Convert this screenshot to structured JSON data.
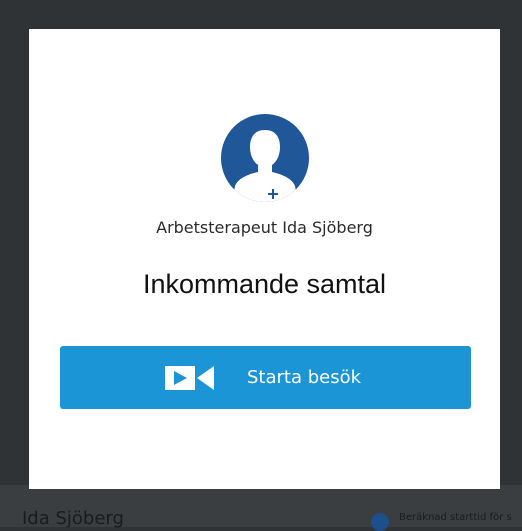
{
  "modal": {
    "caller_name": "Arbetsterapeut Ida Sjöberg",
    "heading": "Inkommande samtal",
    "start_button_label": "Starta besök",
    "avatar_icon": "person-add-icon",
    "button_icon": "video-camera-icon"
  },
  "background_page": {
    "name": "Ida Sjöberg",
    "info_text": "Beräknad starttid för s",
    "info_icon": "info-icon"
  },
  "colors": {
    "backdrop": "#2f3336",
    "avatar": "#1f5799",
    "button": "#1b95d6"
  }
}
